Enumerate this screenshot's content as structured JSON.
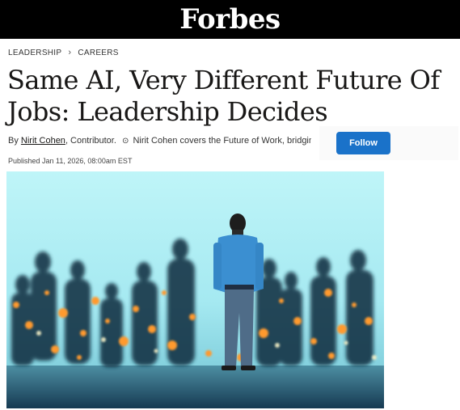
{
  "site": {
    "logo": "Forbes"
  },
  "breadcrumb": {
    "items": [
      "LEADERSHIP",
      "CAREERS"
    ],
    "separator": "›"
  },
  "article": {
    "title": "Same AI, Very Different Future Of Jobs: Leadership Decides",
    "byline_prefix": "By",
    "author": "Nirit Cohen",
    "role": ", Contributor.",
    "badge_icon": "⊙",
    "author_bio": "Nirit Cohen covers the Future of Work, bridgin...",
    "published": "Published Jan 11, 2026, 08:00am EST"
  },
  "follow": {
    "label": "Follow"
  },
  "hero_image": {
    "subject": "businessman-standing-before-crowd-silhouettes",
    "accent_color": "#ff9a2e",
    "sky_color": "#b9f2f7"
  },
  "colors": {
    "topbar": "#000000",
    "follow_button": "#1a72c9"
  }
}
